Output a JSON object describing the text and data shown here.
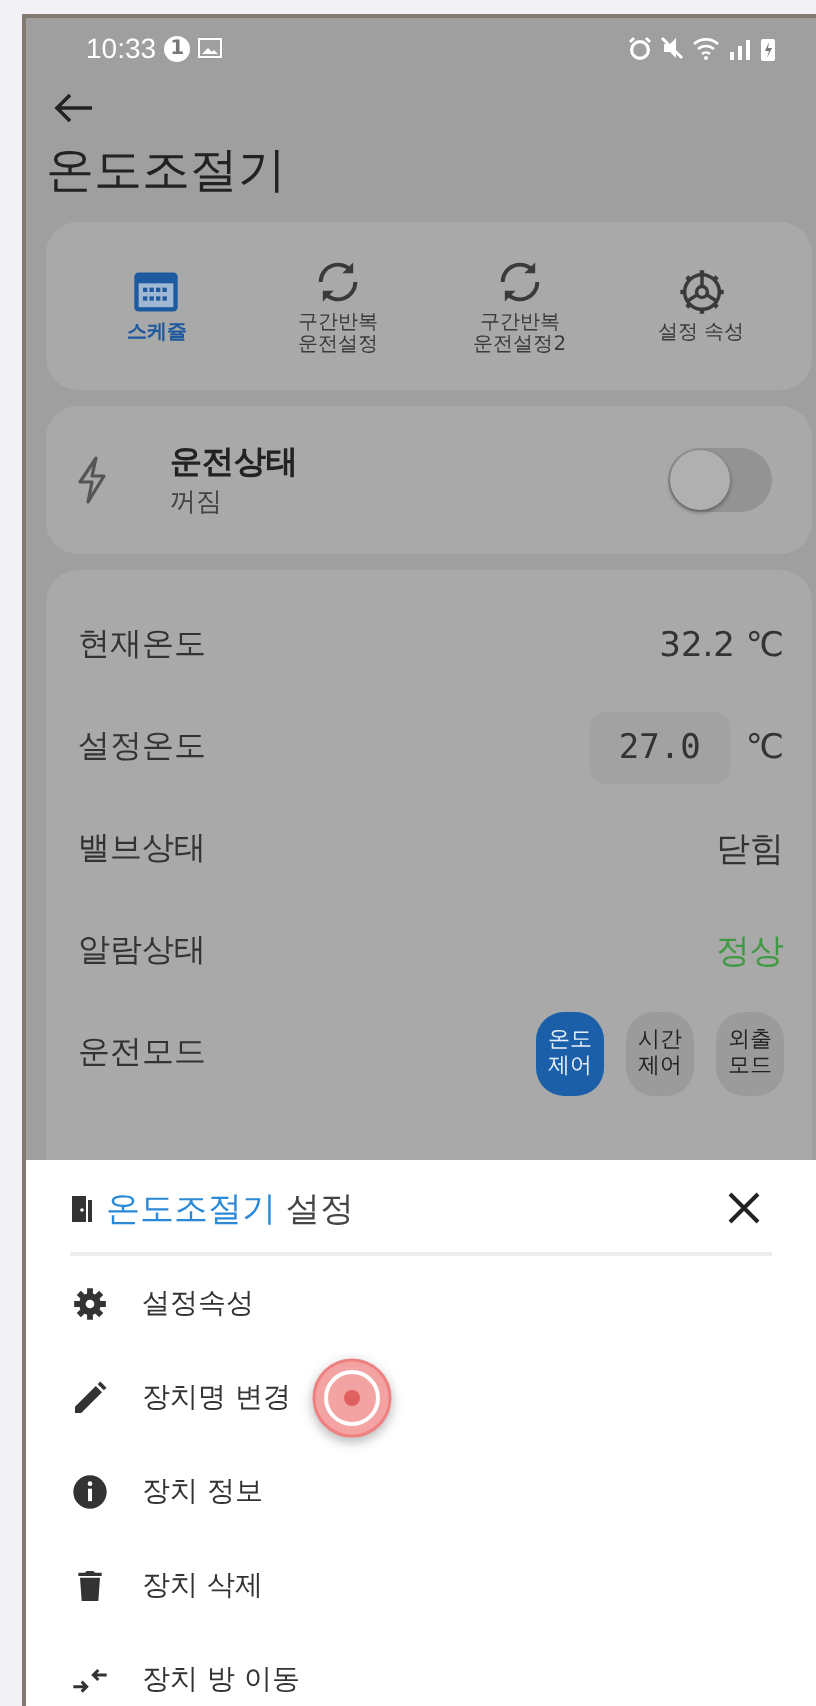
{
  "status_bar": {
    "time": "10:33",
    "badge": "1"
  },
  "title": "온도조절기",
  "tabs": [
    {
      "label": "스케쥴",
      "selected": true
    },
    {
      "label": "구간반복\n운전설정",
      "selected": false
    },
    {
      "label": "구간반복\n운전설정2",
      "selected": false
    },
    {
      "label": "설정 속성",
      "selected": false
    }
  ],
  "power": {
    "title": "운전상태",
    "state": "꺼짐",
    "on": false
  },
  "rows": [
    {
      "kind": "text",
      "label": "현재온도",
      "value": "32.2 ℃",
      "highlight": false
    },
    {
      "kind": "input",
      "label": "설정온도",
      "value": "27.0",
      "unit": "℃"
    },
    {
      "kind": "text",
      "label": "밸브상태",
      "value": "닫힘",
      "highlight": false
    },
    {
      "kind": "text",
      "label": "알람상태",
      "value": "정상",
      "highlight": true
    },
    {
      "kind": "mode",
      "label": "운전모드",
      "modes": [
        {
          "label": "온도\n제어",
          "selected": true
        },
        {
          "label": "시간\n제어",
          "selected": false
        },
        {
          "label": "외출\n모드",
          "selected": false
        }
      ]
    }
  ],
  "sheet": {
    "device": "온도조절기",
    "suffix": "설정",
    "items": [
      {
        "label": "설정속성"
      },
      {
        "label": "장치명 변경"
      },
      {
        "label": "장치 정보"
      },
      {
        "label": "장치 삭제"
      },
      {
        "label": "장치 방 이동"
      }
    ]
  }
}
